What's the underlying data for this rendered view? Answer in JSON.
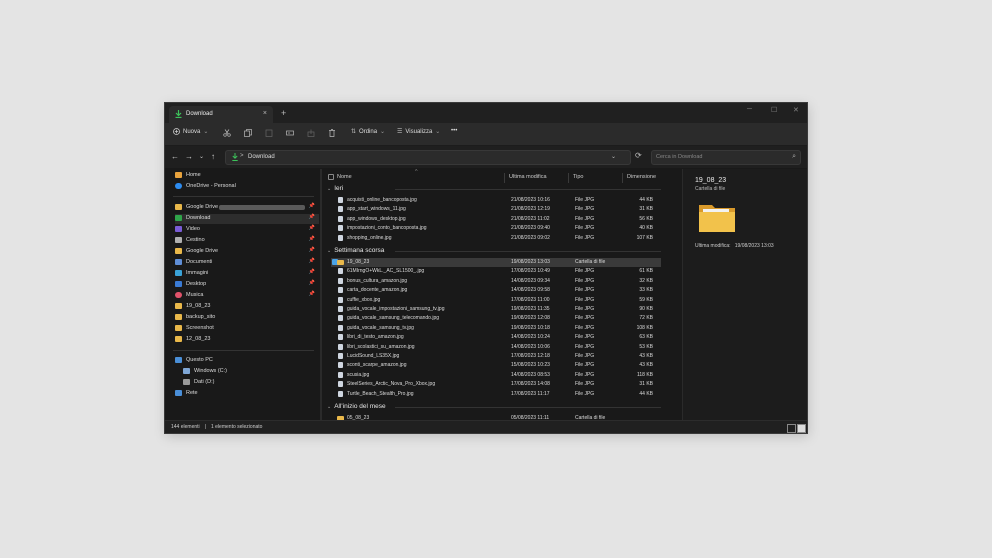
{
  "tab": {
    "title": "Download",
    "close": "×",
    "new": "+"
  },
  "window_controls": {
    "minimize": "─",
    "maximize": "☐",
    "close": "✕"
  },
  "toolbar": {
    "new_label": "Nuova",
    "sort_label": "Ordina",
    "view_label": "Visualizza",
    "more": "•••"
  },
  "nav": {
    "back": "←",
    "forward": "→",
    "down": "⌄",
    "up": "↑",
    "refresh": "⟳"
  },
  "address": {
    "path": "Download",
    "separator": ">",
    "dropdown": "⌄"
  },
  "search": {
    "placeholder": "Cerca in Download",
    "icon": "⌕"
  },
  "sidebar": {
    "items": [
      {
        "label": "Home",
        "color": "#e8a33d"
      },
      {
        "label": "OneDrive - Personal",
        "color": "#2d8cf0"
      },
      {
        "label": "Google Drive",
        "color": "#e9b84a",
        "pin": "📌"
      },
      {
        "label": "Download",
        "color": "#2fa54a",
        "pin": "📌"
      },
      {
        "label": "Video",
        "color": "#7a5cd6",
        "pin": "📌"
      },
      {
        "label": "Cestino",
        "color": "#b0b0b0",
        "pin": "📌"
      },
      {
        "label": "Google Drive",
        "color": "#e9b84a",
        "pin": "📌"
      },
      {
        "label": "Documenti",
        "color": "#5f8ed6",
        "pin": "📌"
      },
      {
        "label": "Immagini",
        "color": "#3aa3d8",
        "pin": "📌"
      },
      {
        "label": "Desktop",
        "color": "#3a7bd5",
        "pin": "📌"
      },
      {
        "label": "Musica",
        "color": "#e0526a",
        "pin": "📌"
      },
      {
        "label": "19_08_23",
        "color": "#e9b84a"
      },
      {
        "label": "backup_sito",
        "color": "#e9b84a"
      },
      {
        "label": "Screenshot",
        "color": "#e9b84a"
      },
      {
        "label": "12_08_23",
        "color": "#e9b84a"
      },
      {
        "label": "Questo PC",
        "color": "#4a8fd8"
      },
      {
        "label": "Windows (C:)",
        "color": "#7fa7d6"
      },
      {
        "label": "Dati (D:)",
        "color": "#9a9a9a"
      },
      {
        "label": "Rete",
        "color": "#4a8fd8"
      }
    ]
  },
  "columns": {
    "name": "Nome",
    "modified": "Ultima modifica",
    "type": "Tipo",
    "size": "Dimensione",
    "sort_arrow": "^"
  },
  "groups": [
    {
      "label": "Ieri",
      "rows": [
        {
          "name": "acquisti_online_bancoposta.jpg",
          "date": "21/08/2023 10:16",
          "type": "File JPG",
          "size": "44 KB"
        },
        {
          "name": "app_start_windows_11.jpg",
          "date": "21/08/2023 12:19",
          "type": "File JPG",
          "size": "31 KB"
        },
        {
          "name": "app_windows_desktop.jpg",
          "date": "21/08/2023 11:02",
          "type": "File JPG",
          "size": "56 KB"
        },
        {
          "name": "impostazioni_conto_bancoposta.jpg",
          "date": "21/08/2023 09:40",
          "type": "File JPG",
          "size": "40 KB"
        },
        {
          "name": "shopping_online.jpg",
          "date": "21/08/2023 09:02",
          "type": "File JPG",
          "size": "107 KB"
        }
      ]
    },
    {
      "label": "Settimana scorsa",
      "rows": [
        {
          "name": "19_08_23",
          "date": "19/08/2023 13:03",
          "type": "Cartella di file",
          "size": "",
          "folder": true,
          "selected": true
        },
        {
          "name": "61MIrngO+WkL._AC_SL1500_.jpg",
          "date": "17/08/2023 10:49",
          "type": "File JPG",
          "size": "61 KB"
        },
        {
          "name": "bonus_cultura_amazon.jpg",
          "date": "14/08/2023 09:34",
          "type": "File JPG",
          "size": "32 KB"
        },
        {
          "name": "carta_docente_amazon.jpg",
          "date": "14/08/2023 09:58",
          "type": "File JPG",
          "size": "33 KB"
        },
        {
          "name": "cuffie_xbox.jpg",
          "date": "17/08/2023 11:00",
          "type": "File JPG",
          "size": "59 KB"
        },
        {
          "name": "guida_vocale_impostazioni_samsung_tv.jpg",
          "date": "19/08/2023 11:35",
          "type": "File JPG",
          "size": "90 KB"
        },
        {
          "name": "guida_vocale_samsung_telecomando.jpg",
          "date": "19/08/2023 12:08",
          "type": "File JPG",
          "size": "72 KB"
        },
        {
          "name": "guida_vocale_samsung_tv.jpg",
          "date": "19/08/2023 10:18",
          "type": "File JPG",
          "size": "108 KB"
        },
        {
          "name": "libri_di_testo_amazon.jpg",
          "date": "14/08/2023 10:24",
          "type": "File JPG",
          "size": "63 KB"
        },
        {
          "name": "libri_scolastici_su_amazon.jpg",
          "date": "14/08/2023 10:06",
          "type": "File JPG",
          "size": "53 KB"
        },
        {
          "name": "LucidSound_LS35X.jpg",
          "date": "17/08/2023 12:18",
          "type": "File JPG",
          "size": "43 KB"
        },
        {
          "name": "sconti_scarpe_amazon.jpg",
          "date": "15/08/2023 10:23",
          "type": "File JPG",
          "size": "43 KB"
        },
        {
          "name": "scusia.jpg",
          "date": "14/08/2023 08:53",
          "type": "File JPG",
          "size": "118 KB"
        },
        {
          "name": "SteelSeries_Arctic_Nova_Pro_Xbox.jpg",
          "date": "17/08/2023 14:08",
          "type": "File JPG",
          "size": "31 KB"
        },
        {
          "name": "Turtle_Beach_Stealth_Pro.jpg",
          "date": "17/08/2023 11:17",
          "type": "File JPG",
          "size": "44 KB"
        }
      ]
    },
    {
      "label": "All'inizio del mese",
      "rows": [
        {
          "name": "05_08_23",
          "date": "05/08/2023 11:11",
          "type": "Cartella di file",
          "size": "",
          "folder": true
        }
      ]
    }
  ],
  "preview": {
    "title": "19_08_23",
    "subtitle": "Cartella di file",
    "modified_label": "Ultima modifica:",
    "modified_value": "19/08/2023 13:03"
  },
  "status": {
    "count": "144 elementi",
    "divider": "|",
    "selection": "1 elemento selezionato"
  }
}
